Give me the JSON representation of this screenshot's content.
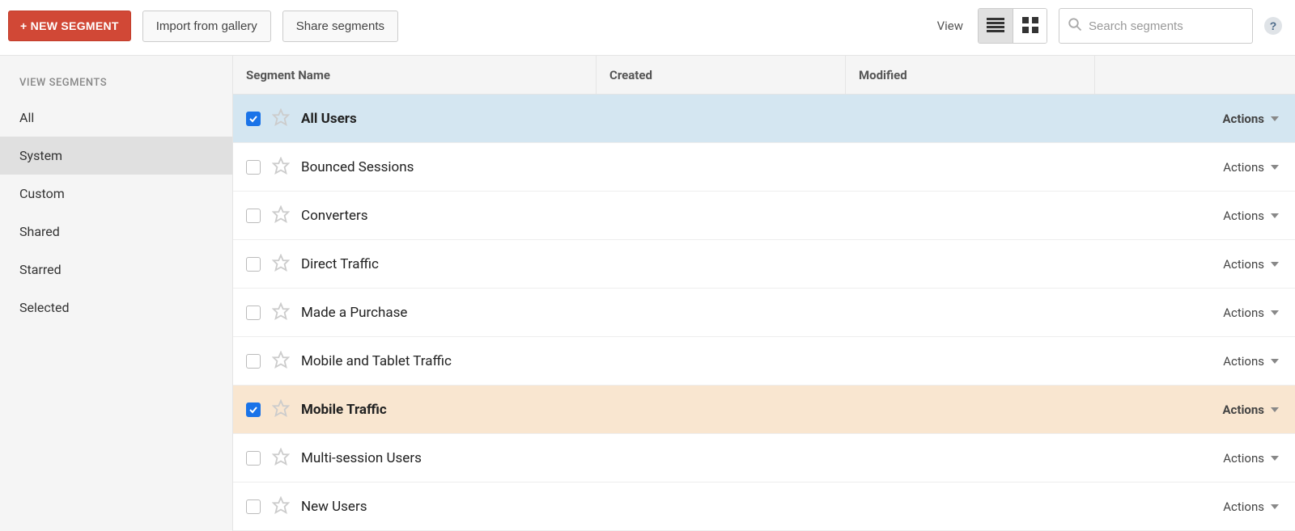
{
  "toolbar": {
    "new_segment_label": "+ NEW SEGMENT",
    "import_label": "Import from gallery",
    "share_label": "Share segments",
    "view_label": "View",
    "search_placeholder": "Search segments",
    "help_label": "?"
  },
  "sidebar": {
    "heading": "VIEW SEGMENTS",
    "items": [
      {
        "label": "All",
        "active": false
      },
      {
        "label": "System",
        "active": true
      },
      {
        "label": "Custom",
        "active": false
      },
      {
        "label": "Shared",
        "active": false
      },
      {
        "label": "Starred",
        "active": false
      },
      {
        "label": "Selected",
        "active": false
      }
    ]
  },
  "table": {
    "columns": {
      "name": "Segment Name",
      "created": "Created",
      "modified": "Modified"
    },
    "actions_label": "Actions",
    "rows": [
      {
        "name": "All Users",
        "checked": true,
        "starred": false,
        "highlight": "blue"
      },
      {
        "name": "Bounced Sessions",
        "checked": false,
        "starred": false,
        "highlight": null
      },
      {
        "name": "Converters",
        "checked": false,
        "starred": false,
        "highlight": null
      },
      {
        "name": "Direct Traffic",
        "checked": false,
        "starred": false,
        "highlight": null
      },
      {
        "name": "Made a Purchase",
        "checked": false,
        "starred": false,
        "highlight": null
      },
      {
        "name": "Mobile and Tablet Traffic",
        "checked": false,
        "starred": false,
        "highlight": null
      },
      {
        "name": "Mobile Traffic",
        "checked": true,
        "starred": false,
        "highlight": "orange"
      },
      {
        "name": "Multi-session Users",
        "checked": false,
        "starred": false,
        "highlight": null
      },
      {
        "name": "New Users",
        "checked": false,
        "starred": false,
        "highlight": null
      }
    ]
  },
  "colors": {
    "primary_button": "#d14836",
    "selected_blue": "#d4e6f1",
    "selected_orange": "#f9e6d0",
    "checkbox_checked": "#1a73e8"
  }
}
